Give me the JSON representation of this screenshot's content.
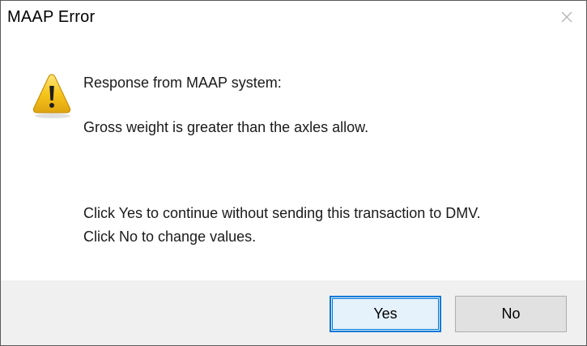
{
  "dialog": {
    "title": "MAAP Error",
    "close_icon": "close-icon"
  },
  "message": {
    "icon": "warning-icon",
    "line1": "Response from MAAP system:",
    "line2": "Gross weight is greater than the axles allow.",
    "line3": "Click Yes to continue without sending this transaction to DMV.",
    "line4": "Click No to change values."
  },
  "buttons": {
    "yes_label": "Yes",
    "no_label": "No"
  },
  "colors": {
    "focus_accent": "#0078d7",
    "warning_fill": "#f6c51b",
    "footer_bg": "#f0f0f0"
  }
}
